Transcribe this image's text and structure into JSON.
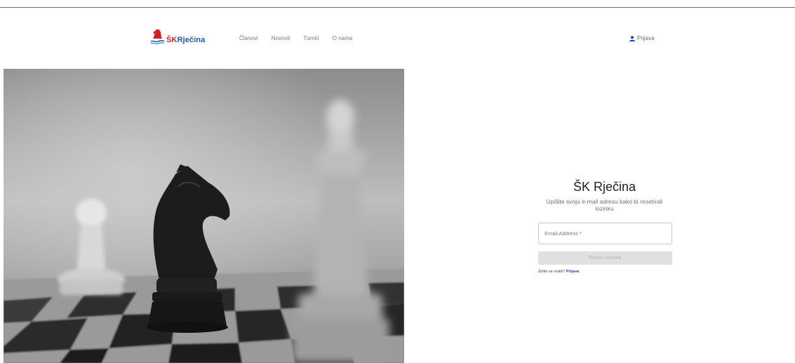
{
  "header": {
    "logo": {
      "prefix": "ŠK",
      "name": "Rječina",
      "brand_red": "#d22027",
      "brand_blue": "#1f55b5",
      "icon": "knight-wave-icon"
    },
    "nav": [
      {
        "label": "Članovi"
      },
      {
        "label": "Novosti"
      },
      {
        "label": "Turniri"
      },
      {
        "label": "O nama"
      }
    ],
    "login": {
      "label": "Prijava",
      "icon": "user-icon"
    }
  },
  "hero": {
    "image": "chess-pieces-photo"
  },
  "reset_form": {
    "title": "ŠK Rječina",
    "subtitle": "Upišite svoju e-mail adresu kako bi resetirali lozinku",
    "email_placeholder": "Email Address *",
    "email_value": "",
    "button_label": "Reset Lozinke",
    "back_text": "Želite se vratiti?",
    "back_link": "Prijava"
  }
}
